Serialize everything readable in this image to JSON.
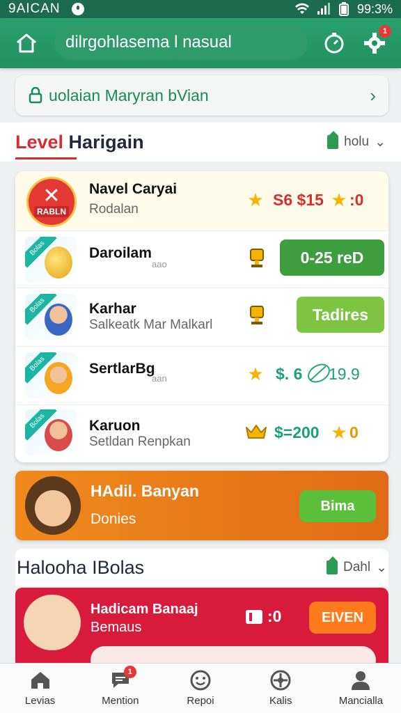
{
  "status_bar": {
    "carrier": "9AICAN",
    "battery": "99:3%"
  },
  "header": {
    "search_text": "dilrgohlasema l nasual",
    "notif_badge": "1"
  },
  "notice": {
    "text": "uolaian Maryran bVian"
  },
  "section1": {
    "title_red": "Level",
    "title_rest": " Harigain",
    "sort_label": "holu"
  },
  "rows": [
    {
      "name": "Navel Caryai",
      "sub": "Rodalan",
      "avatar_label": "RABLN",
      "value": "S6 $15",
      "value2": ":0"
    },
    {
      "name": "Daroilam",
      "small": "aao",
      "ribbon": "Bolas",
      "button": "0-25 reD"
    },
    {
      "name": "Karhar",
      "sub": "Salkeatk Mar Malkarl",
      "ribbon": "Bolas",
      "button": "Tadires"
    },
    {
      "name": "SertlarBg",
      "small": "aan",
      "ribbon": "Bolas",
      "value": "$. 6",
      "value_green": "19.9"
    },
    {
      "name": "Karuon",
      "sub": "Setldan Renpkan",
      "ribbon": "Bolas",
      "value": "$=200",
      "value2": "0"
    }
  ],
  "promo": {
    "title": "HAdil. Banyan",
    "sub": "Donies",
    "button": "Bima"
  },
  "section2": {
    "title": "Halooha IBolas",
    "sort_label": "Dahl"
  },
  "bottom_card": {
    "title": "Hadicam Banaaj",
    "sub": "Bemaus",
    "value": ":0",
    "button": "EIVEN"
  },
  "nav": [
    {
      "label": "Levias"
    },
    {
      "label": "Mention",
      "badge": "1"
    },
    {
      "label": "Repoi"
    },
    {
      "label": "Kalis"
    },
    {
      "label": "Mancialla"
    }
  ],
  "colors": {
    "primary_green": "#239162",
    "accent_red": "#d32f2f",
    "star": "#f4b400",
    "button_green": "#4caf50",
    "button_lime": "#7cc442",
    "promo_orange": "#e8791a",
    "card_red": "#d81b3c"
  },
  "icons": [
    "home-icon",
    "timer-icon",
    "gear-icon",
    "chevron-right-icon",
    "sort-icon",
    "star-icon",
    "trophy-icon",
    "crown-icon",
    "house-icon",
    "chat-icon",
    "smile-icon",
    "compass-icon",
    "person-icon"
  ]
}
